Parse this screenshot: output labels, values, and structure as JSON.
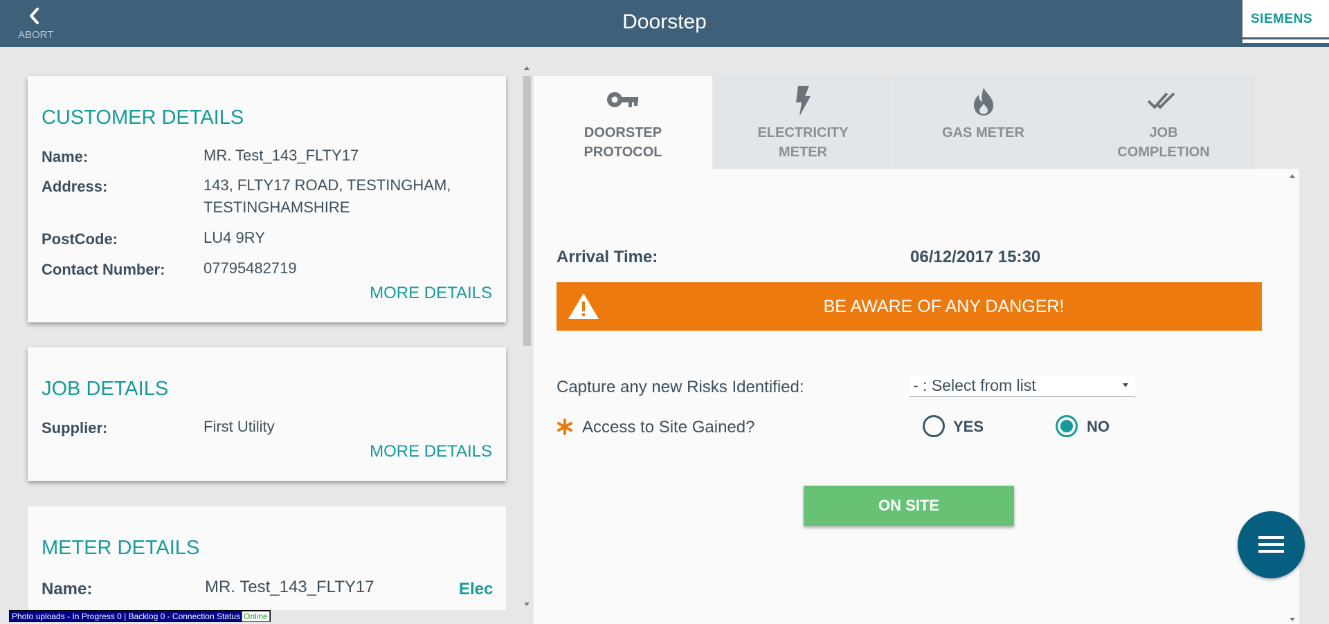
{
  "header": {
    "abort_label": "ABORT",
    "title": "Doorstep",
    "logo": "SIEMENS"
  },
  "customer": {
    "title": "CUSTOMER DETAILS",
    "rows": [
      {
        "label": "Name:",
        "value": "MR. Test_143_FLTY17"
      },
      {
        "label": "Address:",
        "value": "143, FLTY17 ROAD, TESTINGHAM, TESTINGHAMSHIRE"
      },
      {
        "label": "PostCode:",
        "value": "LU4 9RY"
      },
      {
        "label": "Contact Number:",
        "value": "07795482719"
      }
    ],
    "more": "MORE DETAILS"
  },
  "job": {
    "title": "JOB DETAILS",
    "rows": [
      {
        "label": "Supplier:",
        "value": "First Utility"
      }
    ],
    "more": "MORE DETAILS"
  },
  "meter": {
    "title": "METER DETAILS",
    "rows": [
      {
        "label": "Name:",
        "value": "MR. Test_143_FLTY17",
        "tag": "Elec"
      }
    ]
  },
  "tabs": [
    {
      "line1": "DOORSTEP",
      "line2": "PROTOCOL",
      "icon": "key-icon",
      "active": true
    },
    {
      "line1": "ELECTRICITY",
      "line2": "METER",
      "icon": "lightning-bolt-icon",
      "active": false
    },
    {
      "line1": "GAS METER",
      "line2": "",
      "icon": "flame-icon",
      "active": false
    },
    {
      "line1": "JOB",
      "line2": "COMPLETION",
      "icon": "double-check-icon",
      "active": false
    }
  ],
  "panel": {
    "arrival_label": "Arrival Time:",
    "arrival_value": "06/12/2017 15:30",
    "danger_text": "BE AWARE OF ANY DANGER!",
    "risk_label": "Capture any new Risks Identified:",
    "risk_select": "- : Select from list",
    "access_label": "Access to Site Gained?",
    "yes_label": "YES",
    "no_label": "NO",
    "access_selected": "NO",
    "onsite_label": "ON SITE"
  },
  "status_bar": {
    "text": "Photo uploads - In Progress 0 | Backlog 0 - Connection Status",
    "connection": "Online"
  },
  "colors": {
    "header": "#3e6079",
    "accent": "#169a9a",
    "danger": "#ec7a0f",
    "onsite": "#67c276",
    "fab": "#065f80"
  }
}
